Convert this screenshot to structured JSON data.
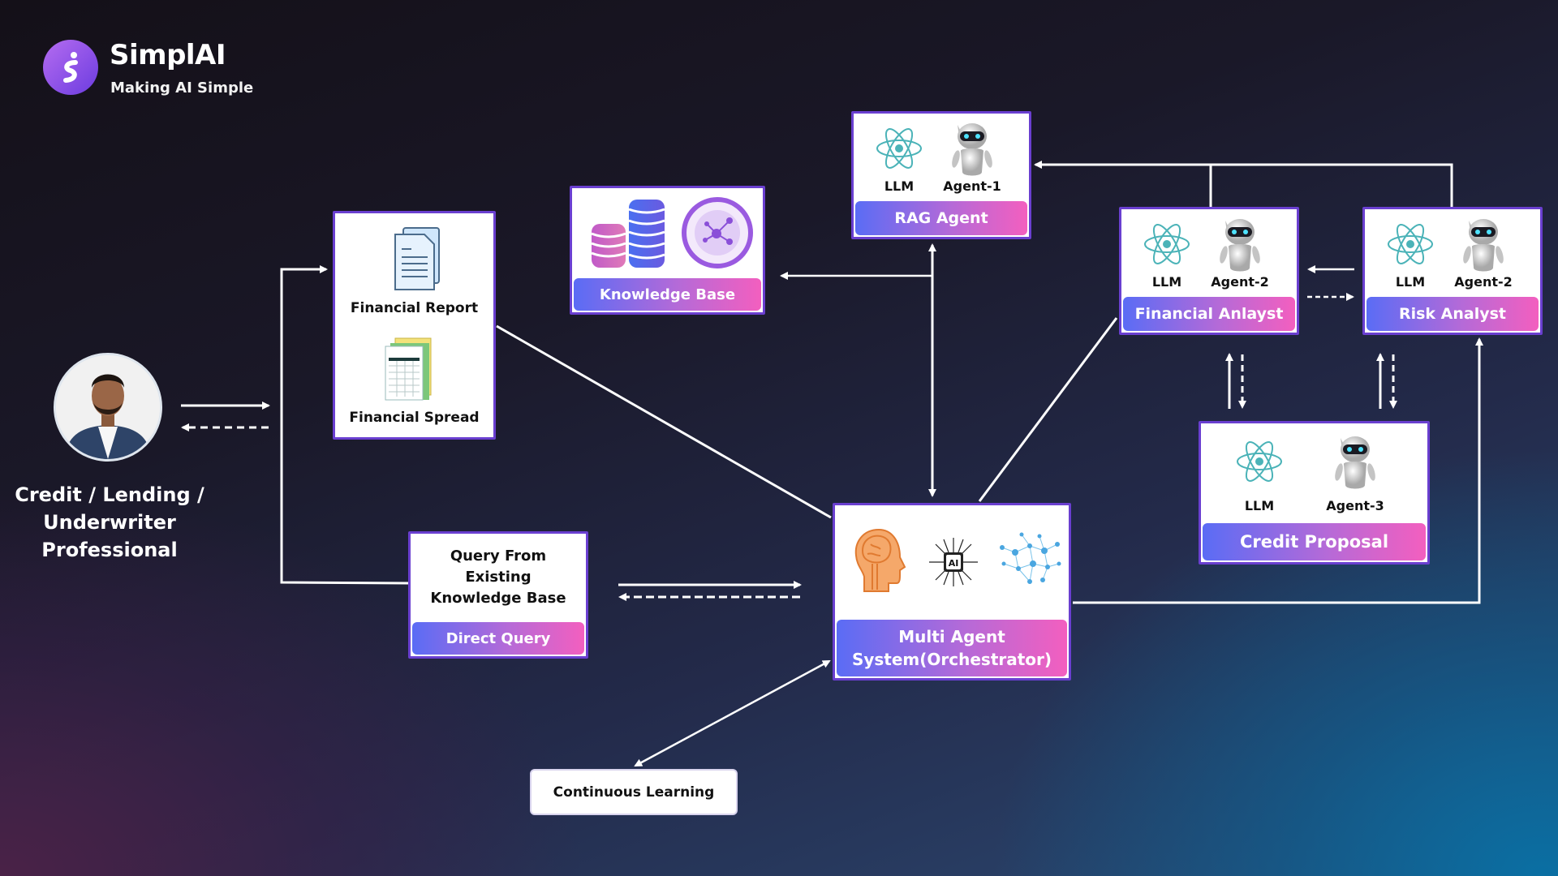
{
  "brand": {
    "name": "SimplAI",
    "tagline": "Making AI Simple",
    "accent": "#8b4fe6"
  },
  "user": {
    "label_lines": [
      "Credit / Lending /",
      "Underwriter",
      "Professional"
    ]
  },
  "documents": {
    "items": [
      {
        "label": "Financial Report",
        "icon": "document-icon"
      },
      {
        "label": "Financial Spread",
        "icon": "spreadsheet-icon"
      }
    ]
  },
  "knowledge_base": {
    "label": "Knowledge Base"
  },
  "rag_agent": {
    "label": "RAG Agent",
    "llm": "LLM",
    "agent": "Agent-1"
  },
  "financial_analyst": {
    "label": "Financial Anlayst",
    "llm": "LLM",
    "agent": "Agent-2"
  },
  "risk_analyst": {
    "label": "Risk Analyst",
    "llm": "LLM",
    "agent": "Agent-2"
  },
  "credit_proposal": {
    "label": "Credit Proposal",
    "llm": "LLM",
    "agent": "Agent-3"
  },
  "orchestrator": {
    "label_line1": "Multi Agent",
    "label_line2": "System(Orchestrator)",
    "chip_text": "AI"
  },
  "direct_query": {
    "label": "Direct Query",
    "text_lines": [
      "Query From",
      "Existing",
      "Knowledge Base"
    ]
  },
  "continuous_learning": {
    "label": "Continuous Learning"
  },
  "colors": {
    "card_border": "#6a3fd0",
    "bar_start": "#5a6cf5",
    "bar_end": "#f35fbf",
    "line": "#ffffff"
  }
}
